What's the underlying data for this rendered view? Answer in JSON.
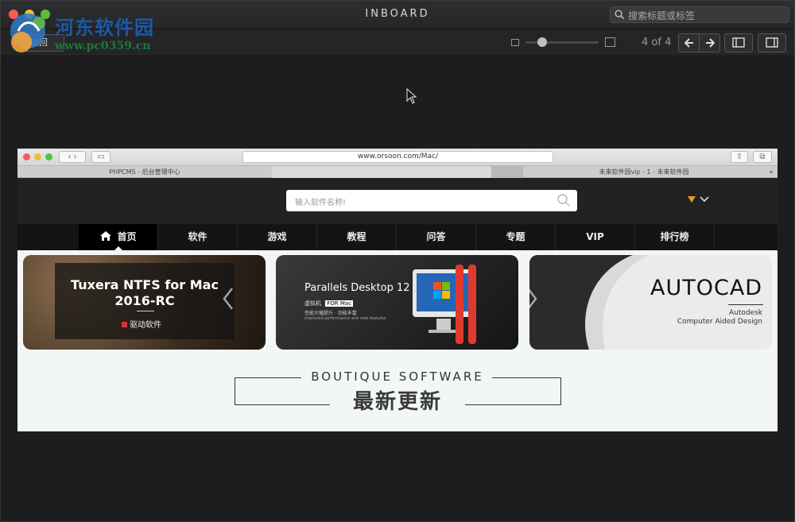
{
  "window": {
    "title": "INBOARD",
    "search_placeholder": "搜索标题或标签"
  },
  "toolbar": {
    "back_label": "返回",
    "page_count": "4 of 4",
    "prev_glyph": "🡐",
    "next_glyph": "🡒"
  },
  "watermark": {
    "title": "河东软件园",
    "url": "www.pc0359.cn"
  },
  "screenshot": {
    "url": "www.orsoon.com/Mac/",
    "tabs": [
      "PHPCMS - 后台管理中心",
      "未来软件园vip - 1 - 未来软件园"
    ],
    "site_search_placeholder": "输入软件名称!",
    "nav": [
      "首页",
      "软件",
      "游戏",
      "教程",
      "问答",
      "专题",
      "VIP",
      "排行榜"
    ],
    "cards": [
      {
        "title_line1": "Tuxera NTFS for Mac",
        "title_line2": "2016-RC",
        "tag": "驱动软件"
      },
      {
        "title": "Parallels Desktop 12",
        "sub1": "虚拟机",
        "badge": "FOR Mac",
        "sub2": "性能大幅提升 · 功能丰富",
        "sub3": "improved performance and new features"
      },
      {
        "title": "AUTOCAD",
        "brand": "Autodesk",
        "subtitle": "Computer Aided Design"
      }
    ],
    "section_heading": "BOUTIQUE SOFTWARE",
    "section_title": "最新更新"
  },
  "colors": {
    "window_bg": "#1d1d1f",
    "watermark_blue": "#1a5aa8",
    "watermark_green": "#1a7a3a",
    "tl_red": "#fc5b57",
    "tl_yellow": "#e5bf3c",
    "tl_green": "#57c038"
  }
}
